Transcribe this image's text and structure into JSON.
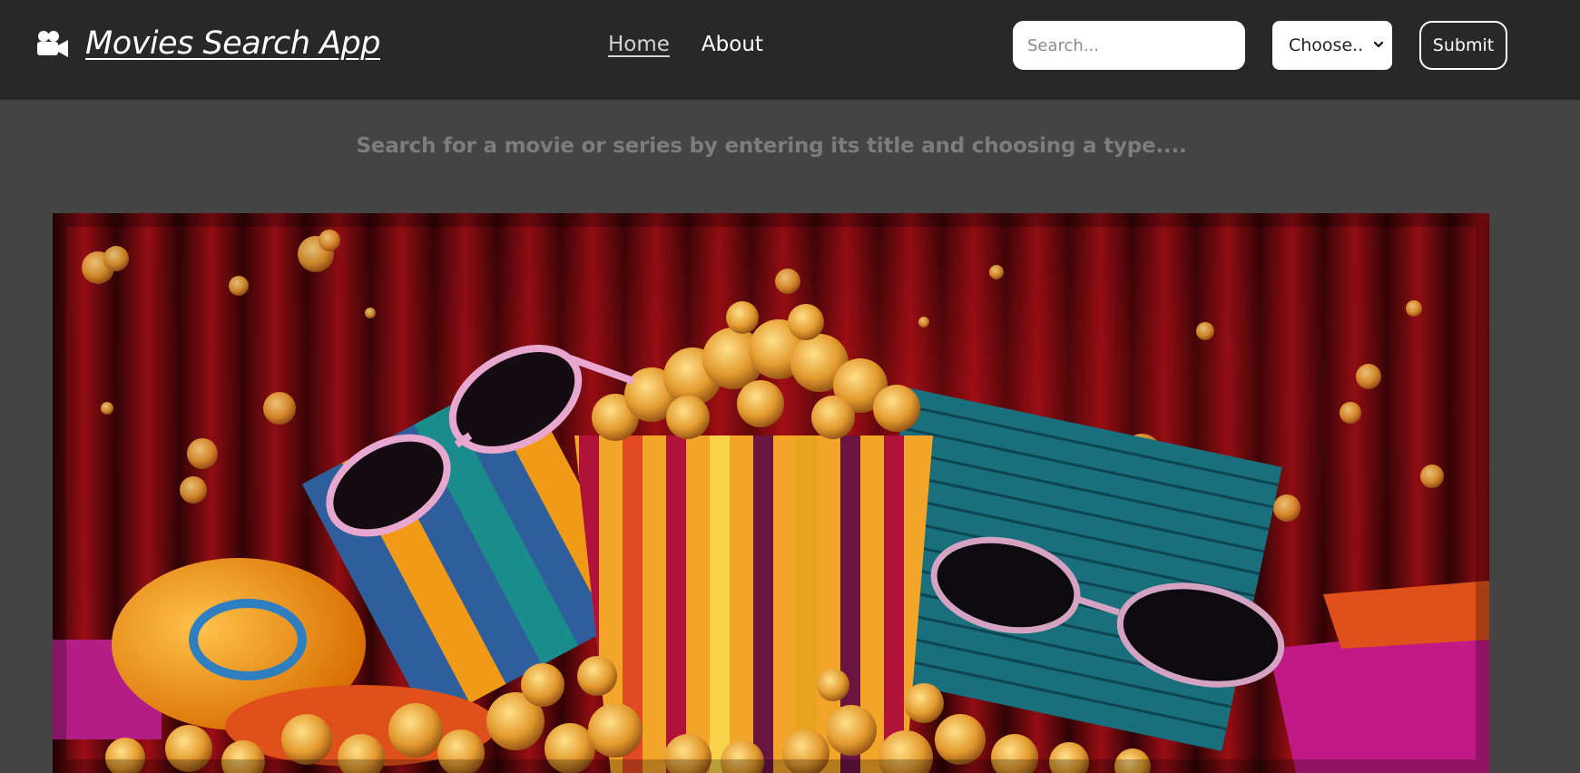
{
  "navbar": {
    "brand_icon": "video-camera-icon",
    "brand_title": "Movies Search App",
    "links": [
      {
        "label": "Home",
        "active": true
      },
      {
        "label": "About",
        "active": false
      }
    ],
    "search": {
      "value": "",
      "placeholder": "Search..."
    },
    "type_select": {
      "selected": "Choose.."
    },
    "submit_label": "Submit"
  },
  "main": {
    "intro": "Search for a movie or series by entering its title and choosing a type...."
  },
  "colors": {
    "navbar_bg": "#282828",
    "page_bg": "#444444",
    "intro_text": "#7d7d7d"
  }
}
